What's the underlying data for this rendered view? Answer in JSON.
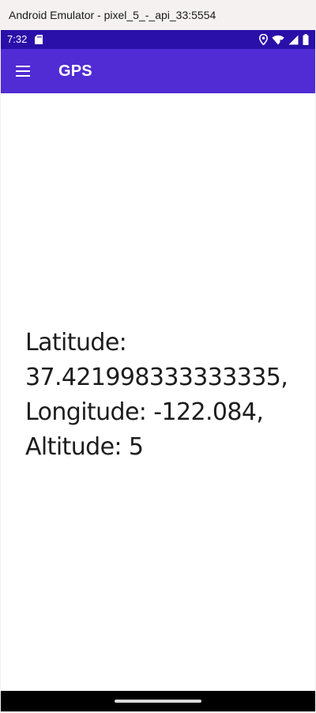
{
  "window": {
    "title": "Android Emulator - pixel_5_-_api_33:5554"
  },
  "status_bar": {
    "time": "7:32",
    "icons": [
      "sd-card-icon",
      "location-icon",
      "wifi-icon",
      "signal-icon",
      "battery-icon"
    ],
    "background": "#2a0fa8"
  },
  "app_bar": {
    "menu_icon": "hamburger-menu-icon",
    "title": "GPS",
    "background": "#512bd4"
  },
  "main": {
    "latitude_line": "Latitude:",
    "latitude_value_line": "37.421998333333335,",
    "longitude_line": "Longitude: -122.084,",
    "altitude_line": "Altitude: 5"
  }
}
